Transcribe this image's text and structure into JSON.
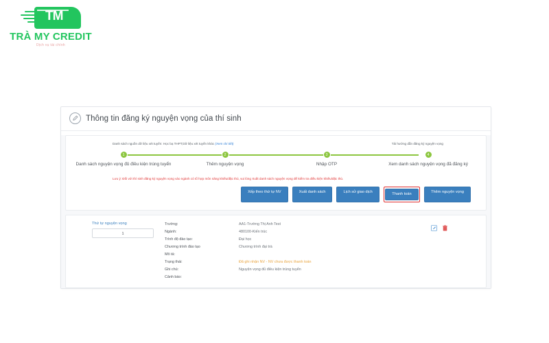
{
  "brand": {
    "mark_text": "TM",
    "name": "TRÀ MY CREDIT",
    "tagline": "Dịch vụ tài chính"
  },
  "panel": {
    "title": "Thông tin đăng ký nguyện vọng của thí sinh",
    "header_icon": "edit-pencil-icon"
  },
  "source": {
    "text": "Danh sách nguồn dữ liệu xét tuyển: Học bạ THPT;Dữ liệu xét tuyển khác",
    "detail_link": "(Xem chi tiết)",
    "guide_link": "Tải hướng dẫn đăng ký nguyện vọng"
  },
  "stepper": {
    "accent_color": "#8cc63f",
    "steps": [
      {
        "number": "1",
        "label": "Danh sách nguyện vọng đủ điều kiện trúng tuyển"
      },
      {
        "number": "2",
        "label": "Thêm nguyện vọng"
      },
      {
        "number": "3",
        "label": "Nhập OTP"
      },
      {
        "number": "4",
        "label": "Xem danh sách nguyện vọng đã đăng ký"
      }
    ]
  },
  "notice": {
    "color": "#e03131",
    "text": "Lưu ý: Đối với thí sinh đăng ký nguyện vọng vào ngành có tổ hợp môn năng khiếu/đặc thù, vui lòng Xuất danh sách nguyện vọng để kiểm tra điều kiện khiếu/đặc thù."
  },
  "actions": {
    "buttons": [
      {
        "label": "Xếp theo thứ tự NV",
        "highlighted": false
      },
      {
        "label": "Xuất danh sách",
        "highlighted": false
      },
      {
        "label": "Lịch sử giao dịch",
        "highlighted": false
      },
      {
        "label": "Thanh toán",
        "highlighted": true
      },
      {
        "label": "Thêm nguyện vọng",
        "highlighted": false
      }
    ],
    "button_color": "#3a7fbe",
    "highlight_color": "#e02b2b"
  },
  "wish_item": {
    "order_label": "Thứ tự nguyện vọng",
    "order_value": "1",
    "fields": [
      {
        "key": "Trường:",
        "value": "AA1-Trường Thị Anh Test",
        "status": false
      },
      {
        "key": "Ngành:",
        "value": "480100-Kiến trúc",
        "status": false
      },
      {
        "key": "Trình độ đào tạo:",
        "value": "Đại học",
        "status": false
      },
      {
        "key": "Chương trình đào tạo",
        "value": "Chương trình đại trà",
        "status": false
      },
      {
        "key": "Mô tả:",
        "value": "",
        "status": false
      },
      {
        "key": "Trạng thái:",
        "value": "Đã ghi nhận NV - NV chưa được thanh toán",
        "status": true
      },
      {
        "key": "Ghi chú:",
        "value": "Nguyện vọng đủ điều kiện trúng tuyển",
        "status": false
      },
      {
        "key": "Cảnh báo:",
        "value": "",
        "status": false
      }
    ],
    "edit_icon": "edit-pencil-icon",
    "delete_icon": "trash-delete-icon"
  }
}
